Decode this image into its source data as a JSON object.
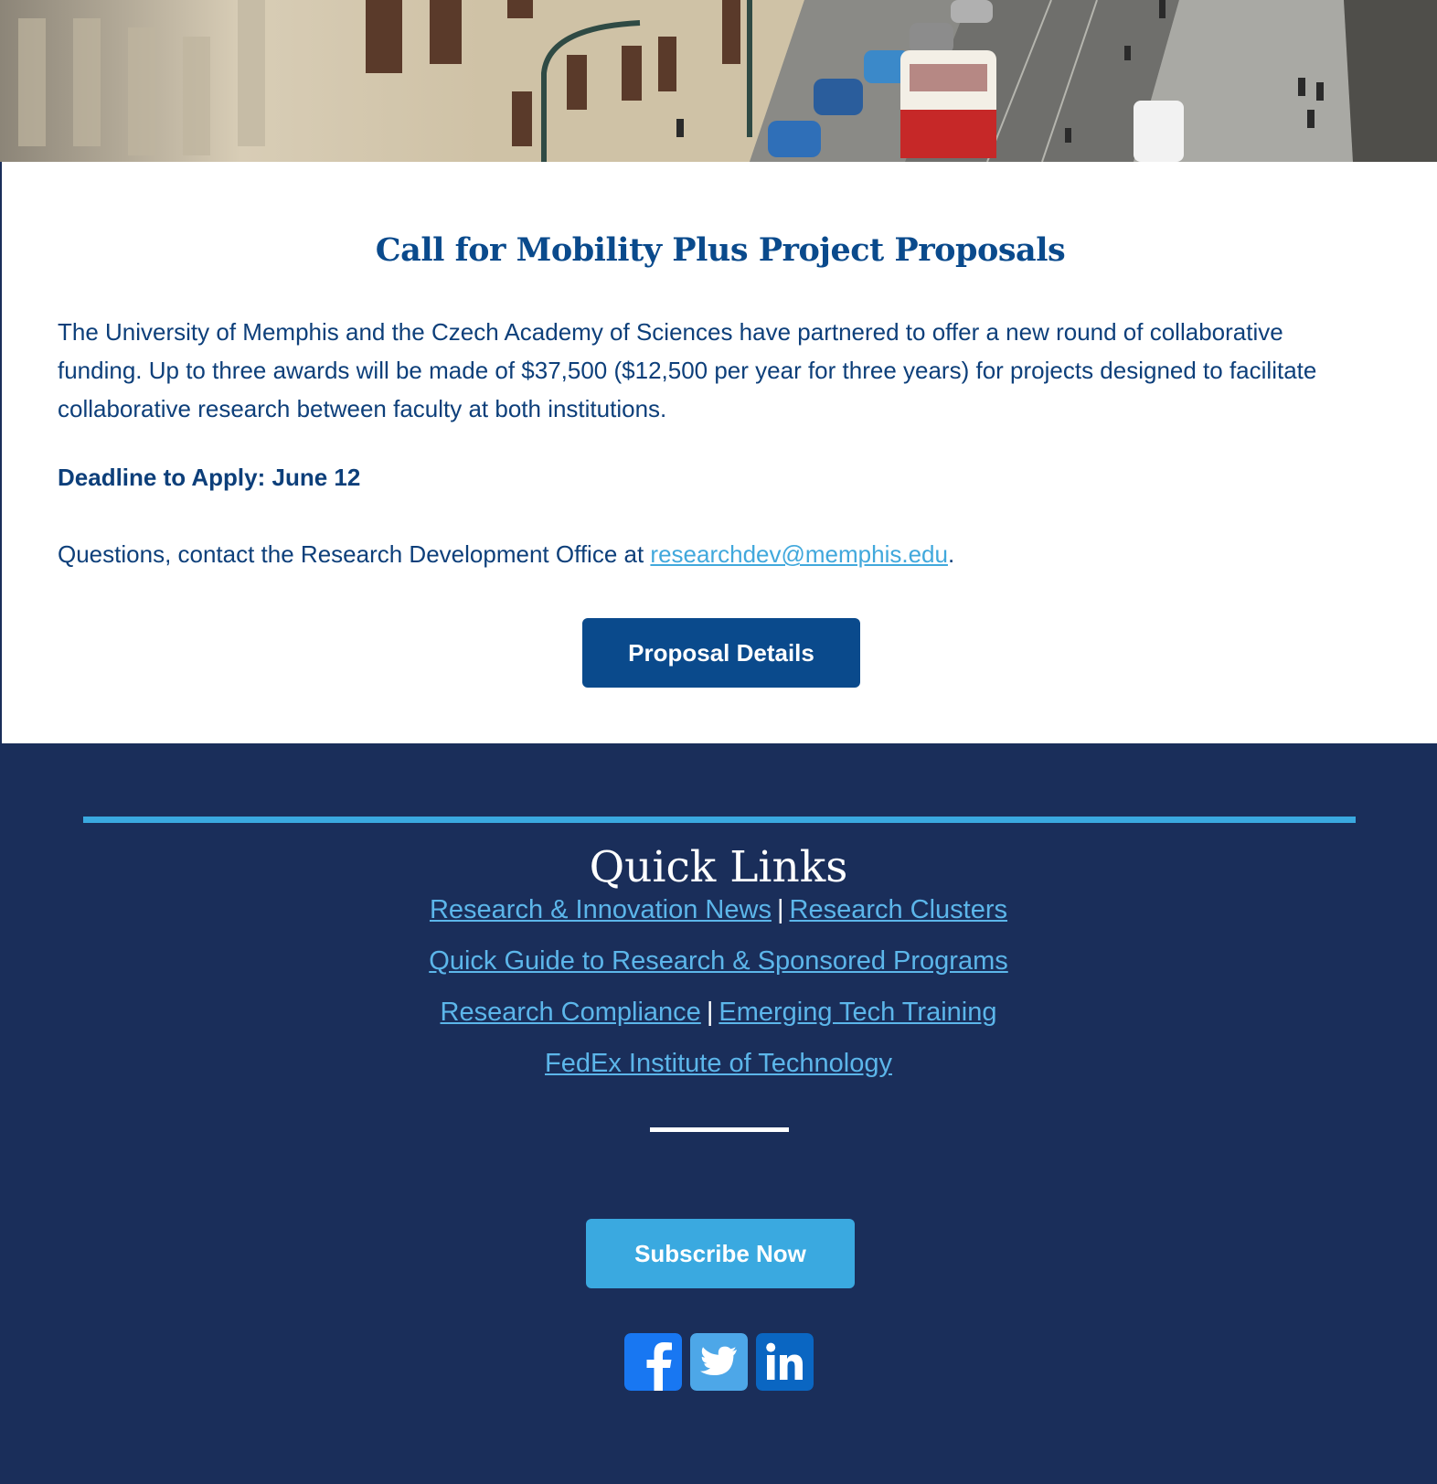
{
  "article": {
    "title": "Call for Mobility Plus Project Proposals",
    "body": "The University of Memphis and the Czech Academy of Sciences have partnered to offer a new round of collaborative funding. Up to three awards will be made of $37,500 ($12,500 per year for three years) for projects designed to facilitate collaborative research between faculty at both institutions.",
    "deadline": "Deadline to Apply: June 12",
    "contact_prefix": "Questions, contact the Research Development Office at ",
    "contact_email": "researchdev@memphis.edu",
    "contact_suffix": ".",
    "button_label": "Proposal Details"
  },
  "footer": {
    "title": "Quick Links",
    "links": {
      "research_news": "Research & Innovation News",
      "research_clusters": "Research Clusters",
      "quick_guide": "Quick Guide to Research & Sponsored Programs",
      "research_compliance": "Research Compliance",
      "emerging_tech": "Emerging Tech Training",
      "fedex_institute": "FedEx Institute of Technology"
    },
    "separator": "|",
    "subscribe_label": "Subscribe Now",
    "social": [
      {
        "name": "facebook-icon",
        "color": "#1877f2"
      },
      {
        "name": "twitter-icon",
        "color": "#4da7e8"
      },
      {
        "name": "linkedin-icon",
        "color": "#0a66c2"
      }
    ]
  },
  "colors": {
    "navy": "#1a2e5a",
    "heading_blue": "#0a4a8c",
    "link_blue": "#5cb6ea",
    "accent_blue": "#3aa9e0"
  }
}
